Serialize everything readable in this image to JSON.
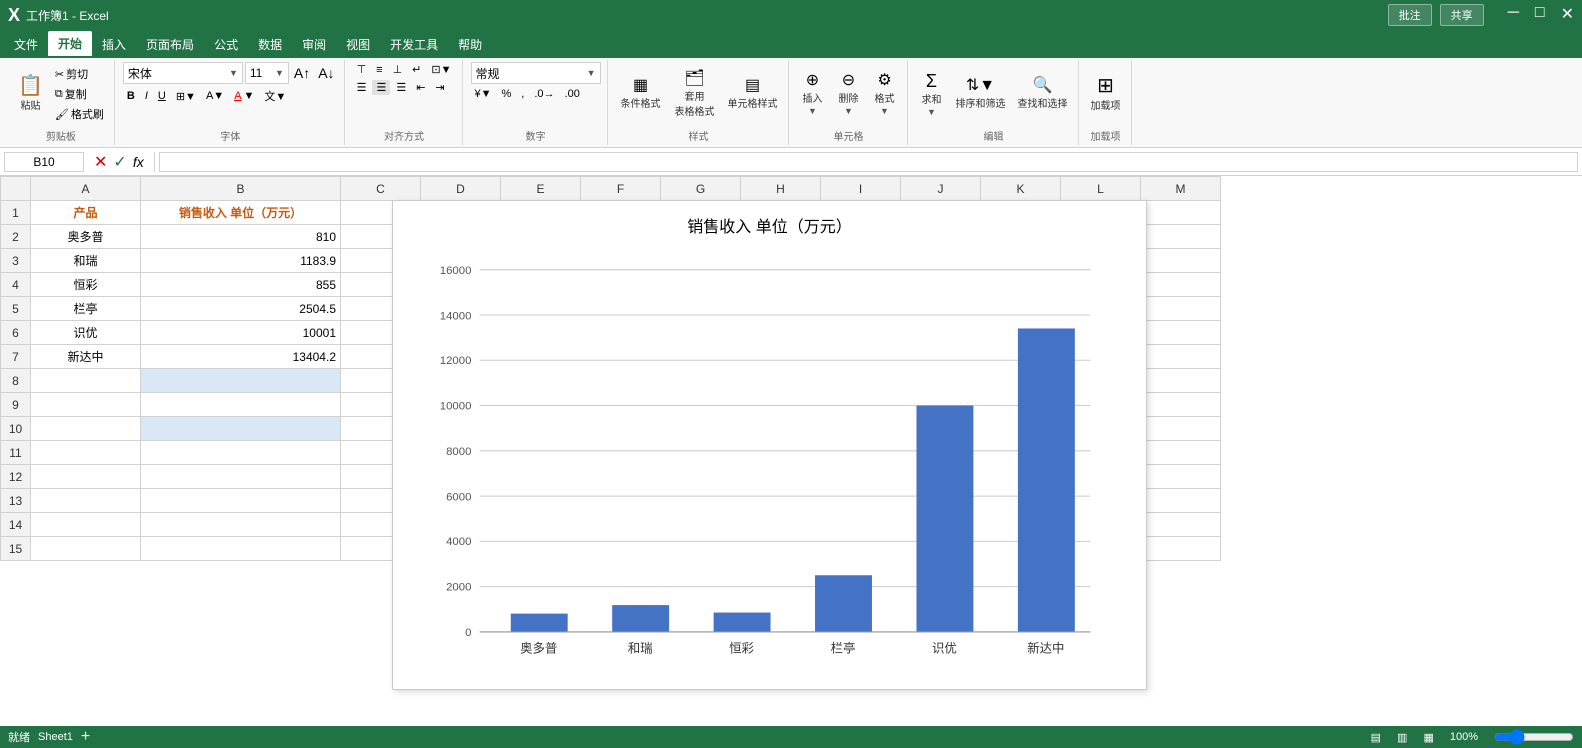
{
  "app": {
    "title": "工作簿1 - Excel",
    "tab_labels": [
      "文件",
      "开始",
      "插入",
      "页面布局",
      "公式",
      "数据",
      "审阅",
      "视图",
      "开发工具",
      "帮助"
    ],
    "active_tab": "开始",
    "comment_btn": "批注",
    "share_btn": "共享"
  },
  "ribbon": {
    "clipboard_group": "剪贴板",
    "font_group": "字体",
    "align_group": "对齐方式",
    "number_group": "数字",
    "styles_group": "样式",
    "cells_group": "单元格",
    "edit_group": "编辑",
    "addins_group": "加载项",
    "font_name": "宋体",
    "font_size": "11",
    "format_type": "常规",
    "paste_label": "粘贴",
    "cut_label": "剪切",
    "copy_label": "复制",
    "format_painter_label": "格式刷",
    "bold_label": "B",
    "italic_label": "I",
    "underline_label": "U",
    "cond_format_label": "条件格式",
    "table_format_label": "套用\n表格格式",
    "cell_style_label": "单元格样式",
    "insert_label": "插入",
    "delete_label": "删除",
    "format_label": "格式",
    "sum_label": "∑",
    "sort_filter_label": "排序和筛选",
    "find_select_label": "查找和选择",
    "addins_label": "加载项"
  },
  "formula_bar": {
    "cell_ref": "B10",
    "formula": ""
  },
  "spreadsheet": {
    "columns": [
      "A",
      "B",
      "C",
      "D",
      "E",
      "F",
      "G",
      "H",
      "I",
      "J",
      "K",
      "L",
      "M"
    ],
    "rows": 15,
    "selected_cell": "B10",
    "data": {
      "A1": "产品",
      "B1": "销售收入 单位（万元）",
      "A2": "奥多普",
      "B2": "810",
      "A3": "和瑞",
      "B3": "1183.9",
      "A4": "恒彩",
      "B4": "855",
      "A5": "栏亭",
      "B5": "2504.5",
      "A6": "识优",
      "B6": "10001",
      "A7": "新达中",
      "B7": "13404.2"
    }
  },
  "chart": {
    "title": "销售收入 单位（万元）",
    "x_labels": [
      "奥多普",
      "和瑞",
      "恒彩",
      "栏亭",
      "识优",
      "新达中"
    ],
    "values": [
      810,
      1183.9,
      855,
      2504.5,
      10001,
      13404.2
    ],
    "max_value": 16000,
    "y_ticks": [
      0,
      2000,
      4000,
      6000,
      8000,
      10000,
      12000,
      14000,
      16000
    ],
    "bar_color": "#4472c4"
  },
  "status_bar": {
    "mode": "就绪",
    "sheet_tabs": [
      "Sheet1"
    ],
    "zoom": "100%"
  }
}
